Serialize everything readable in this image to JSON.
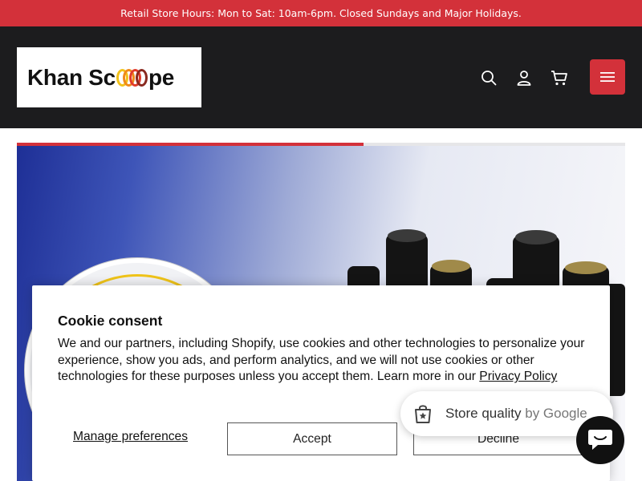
{
  "announcement": {
    "text": "Retail Store Hours: Mon to Sat: 10am-6pm. Closed Sundays and Major Holidays."
  },
  "header": {
    "logo": {
      "part1": "Khan Sc",
      "part2": "pe"
    },
    "icons": [
      "search-icon",
      "account-icon",
      "cart-icon",
      "menu-icon"
    ]
  },
  "hero": {
    "slideshow_progress": 0.57
  },
  "cookie": {
    "title": "Cookie consent",
    "body": "We and our partners, including Shopify, use cookies and other technologies to personalize your experience, show you ads, and perform analytics, and we will not use cookies or other technologies for these purposes unless you accept them. Learn more in our ",
    "link": "Privacy Policy",
    "manage": "Manage preferences",
    "accept": "Accept",
    "decline": "Decline"
  },
  "store_quality": {
    "label": "Store quality",
    "by": "by Google"
  },
  "colors": {
    "accent": "#d3313a",
    "header_bg": "#1c1c1e"
  }
}
